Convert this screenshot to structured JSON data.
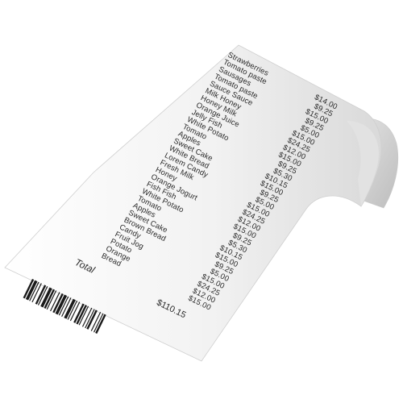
{
  "receipt": {
    "items": [
      {
        "name": "Strawberries",
        "price": "$14.00"
      },
      {
        "name": "Tomato paste",
        "price": "$9.25"
      },
      {
        "name": "Sausages",
        "price": "$15.00"
      },
      {
        "name": "Tomato paste",
        "price": "$9.25"
      },
      {
        "name": "Sauce Sauce",
        "price": "$5.00"
      },
      {
        "name": "Milk Honey",
        "price": "$15.00"
      },
      {
        "name": "Honey Milk",
        "price": "$24.25"
      },
      {
        "name": "Orange Juice",
        "price": "$12.00"
      },
      {
        "name": "Jelly Fish",
        "price": "$15.00"
      },
      {
        "name": "White Potato",
        "price": "$9.25"
      },
      {
        "name": "Tomato",
        "price": "$5.30"
      },
      {
        "name": "Apples",
        "price": "$10.15"
      },
      {
        "name": "Sweet Cake",
        "price": "$15.00"
      },
      {
        "name": "White Bread",
        "price": "$9.25"
      },
      {
        "name": "Lorem Candy",
        "price": "$5.00"
      },
      {
        "name": "Fresh Milk",
        "price": "$15.00"
      },
      {
        "name": "Honey",
        "price": "$24.25"
      },
      {
        "name": "Orange Jogurt",
        "price": "$12.00"
      },
      {
        "name": "Fish Fish",
        "price": "$15.00"
      },
      {
        "name": "White Potato",
        "price": "$9.25"
      },
      {
        "name": "Tomato",
        "price": "$5.30"
      },
      {
        "name": "Apples",
        "price": "$10.15"
      },
      {
        "name": "Sweet Cake",
        "price": "$15.00"
      },
      {
        "name": "Brown Bread",
        "price": "$9.25"
      },
      {
        "name": "Candy",
        "price": "$5.00"
      },
      {
        "name": "Fruit Jog",
        "price": "$15.00"
      },
      {
        "name": "Potato",
        "price": "$24.25"
      },
      {
        "name": "Orange",
        "price": "$12.00"
      },
      {
        "name": "Bread",
        "price": "$15.00"
      }
    ],
    "total_label": "Total",
    "total_value": "$110.15"
  },
  "colors": {
    "paper": "#ffffff",
    "paper_shade": "#e9e9e9",
    "paper_edge": "#cfcfcf",
    "ink": "#2a2a2a",
    "barcode": "#1a1a1a"
  }
}
